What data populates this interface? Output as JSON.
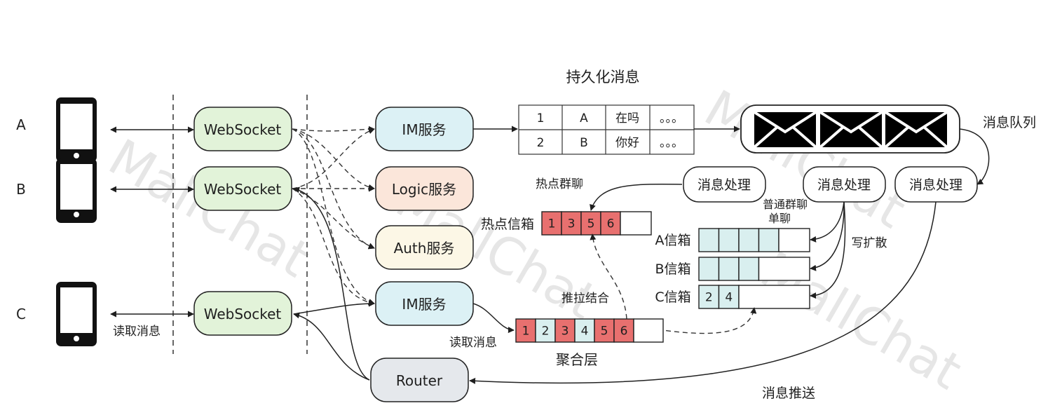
{
  "clients": {
    "a": "A",
    "b": "B",
    "c": "C"
  },
  "websocket": {
    "label": "WebSocket"
  },
  "services": {
    "im_top": "IM服务",
    "logic": "Logic服务",
    "auth": "Auth服务",
    "im_bottom": "IM服务",
    "router": "Router"
  },
  "persist": {
    "title": "持久化消息",
    "rows": [
      [
        "1",
        "A",
        "在吗",
        "。。。"
      ],
      [
        "2",
        "B",
        "你好",
        "。。。"
      ]
    ]
  },
  "mq": {
    "label": "消息队列"
  },
  "processors": [
    "消息处理",
    "消息处理",
    "消息处理"
  ],
  "hot": {
    "caption": "热点群聊",
    "label": "热点信箱",
    "cells": [
      "1",
      "3",
      "5",
      "6",
      ""
    ]
  },
  "group_caption_1": "普通群聊",
  "group_caption_2": "单聊",
  "write_spread": "写扩散",
  "inboxes": [
    {
      "label": "A信箱",
      "cells": [
        "",
        "",
        "",
        "",
        ""
      ]
    },
    {
      "label": "B信箱",
      "cells": [
        "",
        "",
        "",
        ""
      ]
    },
    {
      "label": "C信箱",
      "cells": [
        "2",
        "4",
        ""
      ]
    }
  ],
  "push_pull": "推拉结合",
  "aggregate": {
    "cells": [
      "1",
      "2",
      "3",
      "4",
      "5",
      "6",
      ""
    ],
    "label": "聚合层"
  },
  "read_msg_left": "读取消息",
  "read_msg_right": "读取消息",
  "push_label": "消息推送",
  "watermark": "MallChat",
  "colors": {
    "ws_fill": "#e2f3d9",
    "im_fill": "#dcf1f5",
    "logic_fill": "#fbe6da",
    "auth_fill": "#fcf7e6",
    "router_fill": "#e5e8ec",
    "red_cell": "#e8706f",
    "teal_cell": "#d9efef"
  }
}
